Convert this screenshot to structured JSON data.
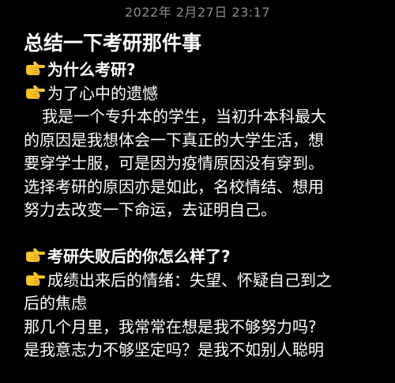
{
  "header": {
    "timestamp": "2022年 2月27日 23:17"
  },
  "note": {
    "title": "总结一下考研那件事",
    "lines": {
      "q1": "为什么考研?",
      "a1": "为了心中的遗憾",
      "p1": "我是一个专升本的学生，当初升本科最大",
      "p2": "的原因是我想体会一下真正的大学生活，想",
      "p3": "要穿学士服，可是因为疫情原因没有穿到。",
      "p4": "选择考研的原因亦是如此，名校情结、想用",
      "p5": "努力去改变一下命运，去证明自己。",
      "q2": "考研失败后的你怎么样了?",
      "a2": "成绩出来后的情绪：失望、怀疑自己到之",
      "a2b": "后的焦虑",
      "p6": "那几个月里，我常常在想是我不够努力吗?",
      "p7": "是我意志力不够坚定吗？是我不如别人聪明"
    }
  },
  "icons": {
    "bullet": "backhand-index-pointing-right-icon"
  },
  "colors": {
    "background": "#000000",
    "text": "#ffffff",
    "timestamp": "#8e8e93",
    "emoji_skin": "#f7c325"
  }
}
